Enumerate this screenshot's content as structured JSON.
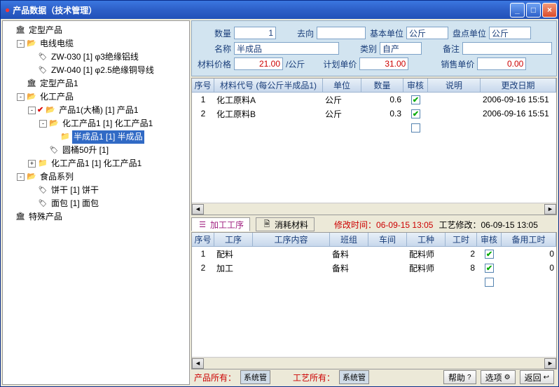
{
  "window": {
    "title": "产品数据（技术管理）"
  },
  "tree": {
    "root1": {
      "label": "定型产品"
    },
    "cable": {
      "label": "电线电缆"
    },
    "zw030": {
      "label": "ZW-030  [1] φ3绝缘铝线"
    },
    "zw040": {
      "label": "ZW-040  [1] φ2.5绝缘铜导线"
    },
    "fixed1": {
      "label": "定型产品1"
    },
    "chem": {
      "label": "化工产品"
    },
    "prod1": {
      "label": "产品1(大桶)  [1] 产品1"
    },
    "chem1": {
      "label": "化工产品1  [1] 化工产品1"
    },
    "semi1": {
      "label": "半成品1  [1] 半成品"
    },
    "barrel": {
      "label": "圆桶50升  [1]"
    },
    "chem1b": {
      "label": "化工产品1  [1] 化工产品1"
    },
    "food": {
      "label": "食品系列"
    },
    "biscuit": {
      "label": "饼干  [1] 饼干"
    },
    "bread": {
      "label": "面包  [1] 面包"
    },
    "root2": {
      "label": "特殊产品"
    }
  },
  "form": {
    "qty_lbl": "数量",
    "qty_val": "1",
    "dir_lbl": "去向",
    "dir_val": "",
    "base_lbl": "基本单位",
    "base_val": "公斤",
    "inv_lbl": "盘点单位",
    "inv_val": "公斤",
    "name_lbl": "名称",
    "name_val": "半成品",
    "cat_lbl": "类别",
    "cat_val": "自产",
    "note_lbl": "备注",
    "note_val": "",
    "matprice_lbl": "材料价格",
    "matprice_val": "21.00",
    "unit_suffix": "/公斤",
    "plan_lbl": "计划单价",
    "plan_val": "31.00",
    "sale_lbl": "销售单价",
    "sale_val": "0.00"
  },
  "grid1": {
    "headers": {
      "seq": "序号",
      "code": "材料代号 (每公斤半成品1)",
      "unit": "单位",
      "qty": "数量",
      "audit": "审核",
      "note": "说明",
      "date": "更改日期"
    },
    "rows": [
      {
        "seq": "1",
        "code": "化工原料A",
        "unit": "公斤",
        "qty": "0.6",
        "audit": true,
        "note": "",
        "date": "2006-09-16 15:51"
      },
      {
        "seq": "2",
        "code": "化工原料B",
        "unit": "公斤",
        "qty": "0.3",
        "audit": true,
        "note": "",
        "date": "2006-09-16 15:51"
      }
    ]
  },
  "tabs": {
    "t1": "加工工序",
    "t2": "消耗材料",
    "mod_lbl": "修改时间：",
    "mod_val": "06-09-15 13:05",
    "rev_lbl": "工艺修改：",
    "rev_val": "06-09-15 13:05"
  },
  "grid2": {
    "headers": {
      "seq": "序号",
      "op": "工序",
      "content": "工序内容",
      "team": "班组",
      "shop": "车间",
      "type": "工种",
      "hr": "工时",
      "audit": "审核",
      "spare": "备用工时"
    },
    "rows": [
      {
        "seq": "1",
        "op": "配料",
        "content": "",
        "team": "备料",
        "shop": "",
        "type": "配料师",
        "hr": "2",
        "audit": true,
        "spare": "0"
      },
      {
        "seq": "2",
        "op": "加工",
        "content": "",
        "team": "备料",
        "shop": "",
        "type": "配料师",
        "hr": "8",
        "audit": true,
        "spare": "0"
      }
    ]
  },
  "bottom": {
    "prod_own": "产品所有：",
    "prod_own_v": "系统管",
    "proc_own": "工艺所有：",
    "proc_own_v": "系统管",
    "help": "帮助",
    "opts": "选项",
    "back": "返回"
  }
}
